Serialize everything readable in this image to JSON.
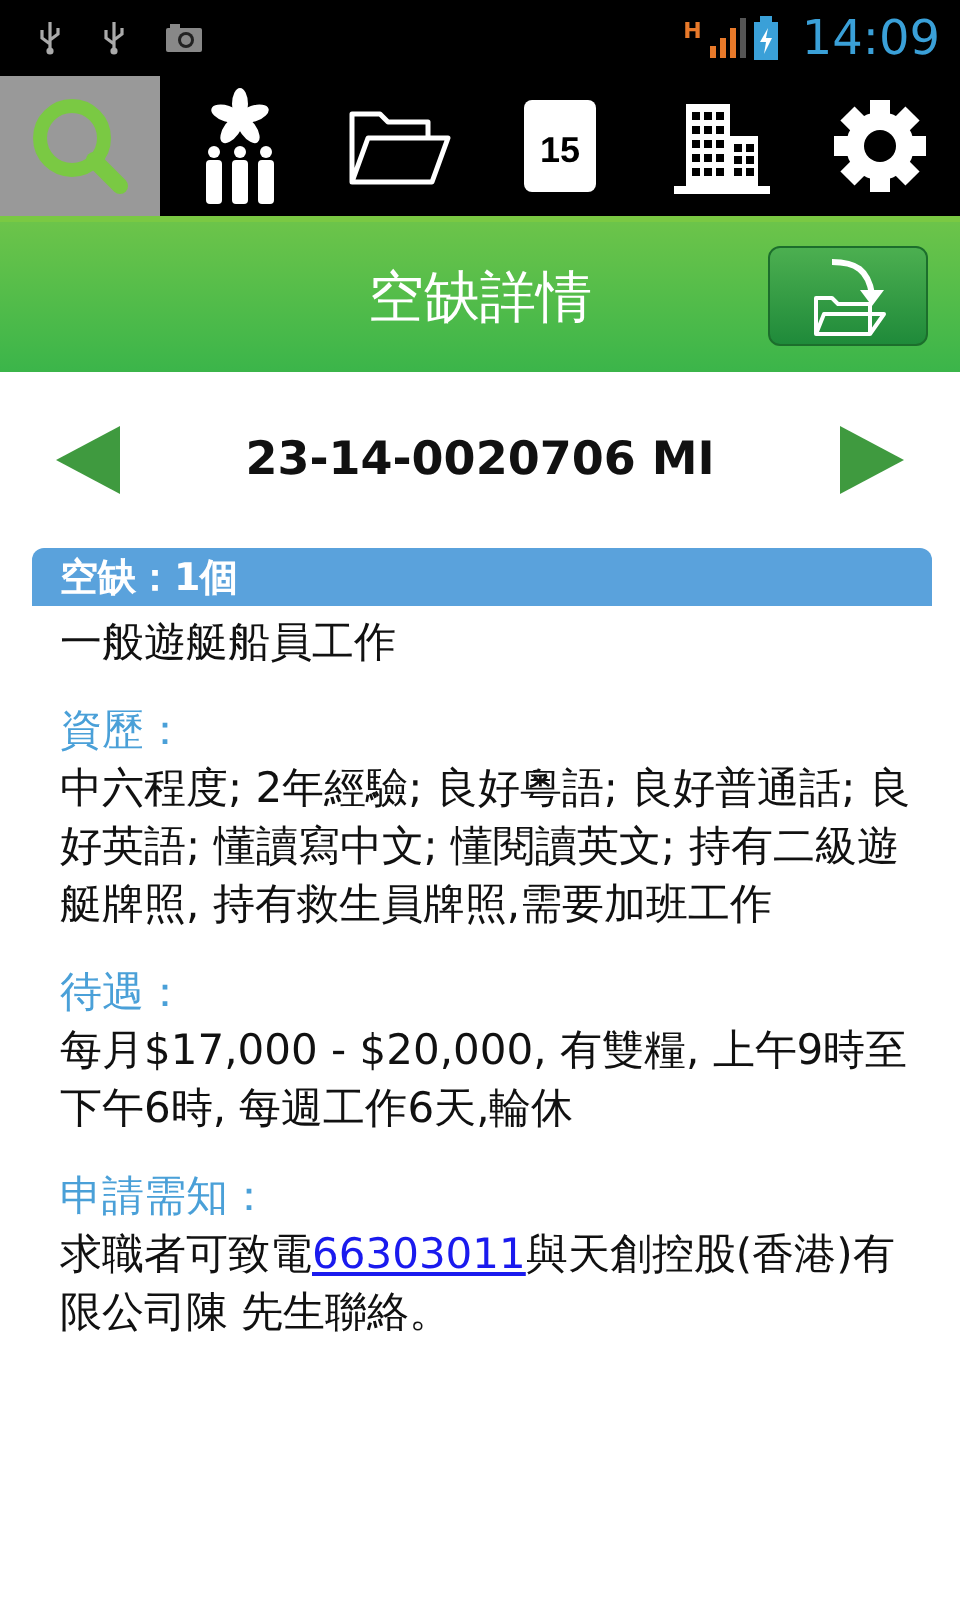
{
  "status_bar": {
    "network": "H",
    "time": "14:09"
  },
  "tabs": [
    {
      "kind": "search",
      "selected": true
    },
    {
      "kind": "people",
      "selected": false
    },
    {
      "kind": "folder",
      "selected": false
    },
    {
      "kind": "calendar",
      "label": "15",
      "selected": false
    },
    {
      "kind": "building",
      "selected": false
    },
    {
      "kind": "settings",
      "selected": false
    }
  ],
  "title_bar": {
    "title": "空缺詳情"
  },
  "record": {
    "number": "23-14-0020706 MI"
  },
  "vacancy_header": "空缺：1個",
  "job_title": "一般遊艇船員工作",
  "sections": [
    {
      "heading": "資歷：",
      "body": "中六程度; 2年經驗; 良好粵語; 良好普通話; 良好英語; 懂讀寫中文; 懂閱讀英文; 持有二級遊艇牌照, 持有救生員牌照,需要加班工作"
    },
    {
      "heading": "待遇：",
      "body": "每月$17,000 - $20,000, 有雙糧, 上午9時至下午6時, 每週工作6天,輪休"
    },
    {
      "heading": "申請需知：",
      "body": "求職者可致電",
      "link": "66303011",
      "body_after": "與天創控股(香港)有限公司陳 先生聯絡。"
    }
  ]
}
